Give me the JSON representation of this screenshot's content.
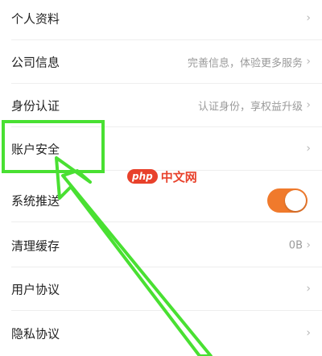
{
  "settings": {
    "rows": [
      {
        "label": "个人资料",
        "value": "",
        "chevron": "›"
      },
      {
        "label": "公司信息",
        "value": "完善信息，体验更多服务",
        "chevron": "›"
      },
      {
        "label": "身份认证",
        "value": "认证身份，享权益升级",
        "chevron": "›"
      },
      {
        "label": "账户安全",
        "value": "",
        "chevron": "›"
      },
      {
        "label": "系统推送",
        "toggle_on": true
      },
      {
        "label": "清理缓存",
        "value": "0B",
        "chevron": "›"
      },
      {
        "label": "用户协议",
        "value": "",
        "chevron": "›"
      },
      {
        "label": "隐私协议",
        "value": "",
        "chevron": "›"
      }
    ]
  },
  "watermark": {
    "badge": "php",
    "site": "中文网"
  },
  "colors": {
    "accent": "#f07a2c",
    "highlight": "#49e032",
    "watermark": "#e8412b"
  },
  "icons": [
    "chevron-right-icon",
    "toggle-switch",
    "arrow-annotation"
  ]
}
